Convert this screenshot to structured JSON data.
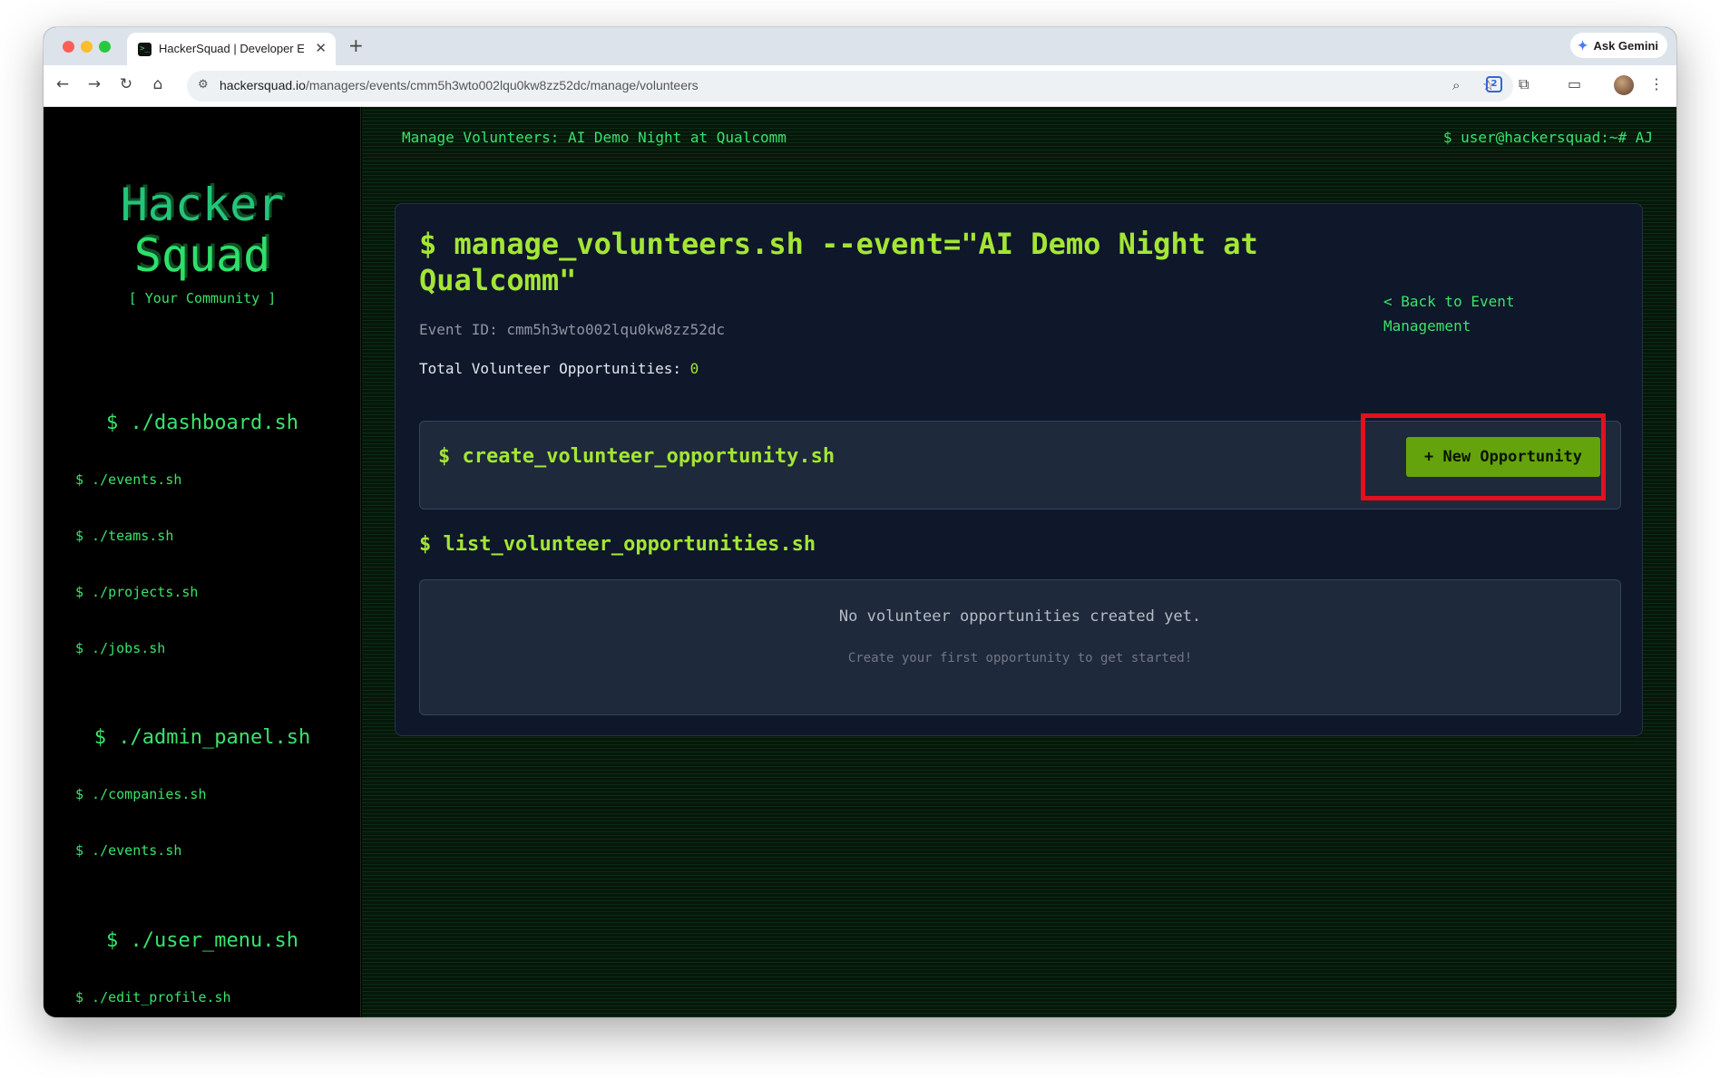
{
  "browser": {
    "tab_title": "HackerSquad | Developer Eco",
    "tab_favicon": ">_",
    "url_domain": "hackersquad.io",
    "url_path": "/managers/events/cmm5h3wto002lqu0kw8zz52dc/manage/volunteers",
    "gemini_label": "Ask Gemini",
    "extension_count": "2"
  },
  "sidebar": {
    "logo_line1": "Hacker",
    "logo_line2": "Squad",
    "tagline": "[ Your Community ]",
    "sections": [
      {
        "title": "$ ./dashboard.sh",
        "items": [
          "$ ./events.sh",
          "$ ./teams.sh",
          "$ ./projects.sh",
          "$ ./jobs.sh"
        ]
      },
      {
        "title": "$ ./admin_panel.sh",
        "items": [
          "$ ./companies.sh",
          "$ ./events.sh"
        ]
      },
      {
        "title": "$ ./user_menu.sh",
        "items": [
          "$ ./edit_profile.sh"
        ]
      }
    ]
  },
  "header": {
    "title": "Manage Volunteers: AI Demo Night at Qualcomm",
    "user": "$ user@hackersquad:~# AJ"
  },
  "main": {
    "command_title": "$ manage_volunteers.sh --event=\"AI Demo Night at Qualcomm\"",
    "back_link": "< Back to Event Management",
    "event_id": "Event ID: cmm5h3wto002lqu0kw8zz52dc",
    "total_label": "Total Volunteer Opportunities: ",
    "total_value": "0",
    "create_title": "$ create_volunteer_opportunity.sh",
    "new_button": "+ New Opportunity",
    "list_title": "$ list_volunteer_opportunities.sh",
    "empty_message": "No volunteer opportunities created yet.",
    "empty_hint": "Create your first opportunity to get started!"
  },
  "colors": {
    "accent_lime": "#a3e635",
    "terminal_green": "#39e36c",
    "button_green": "#65a30d",
    "highlight_red": "#e4101e",
    "card_bg": "#0f172a"
  }
}
